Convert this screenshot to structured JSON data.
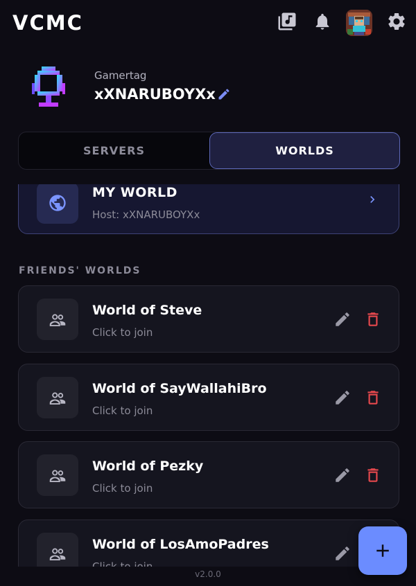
{
  "app": {
    "title": "VCMC"
  },
  "header": {
    "icons": [
      "music-library-icon",
      "bell-icon",
      "avatar",
      "gear-icon"
    ]
  },
  "profile": {
    "label": "Gamertag",
    "gamertag": "xXNARUBOYXx"
  },
  "tabs": [
    {
      "label": "SERVERS",
      "active": false
    },
    {
      "label": "WORLDS",
      "active": true
    }
  ],
  "my_world": {
    "title": "MY WORLD",
    "host": "Host: xXNARUBOYXx"
  },
  "friends_section": {
    "label": "FRIENDS' WORLDS",
    "worlds": [
      {
        "title": "World of Steve",
        "subtitle": "Click to join"
      },
      {
        "title": "World of SayWallahiBro",
        "subtitle": "Click to join"
      },
      {
        "title": "World of Pezky",
        "subtitle": "Click to join"
      },
      {
        "title": "World of LosAmoPadres",
        "subtitle": "Click to join"
      }
    ]
  },
  "footer": {
    "version": "v2.0.0"
  },
  "colors": {
    "accent": "#6b8cff",
    "delete": "#e5484d",
    "background": "#0d0c14",
    "card": "#15151f"
  }
}
